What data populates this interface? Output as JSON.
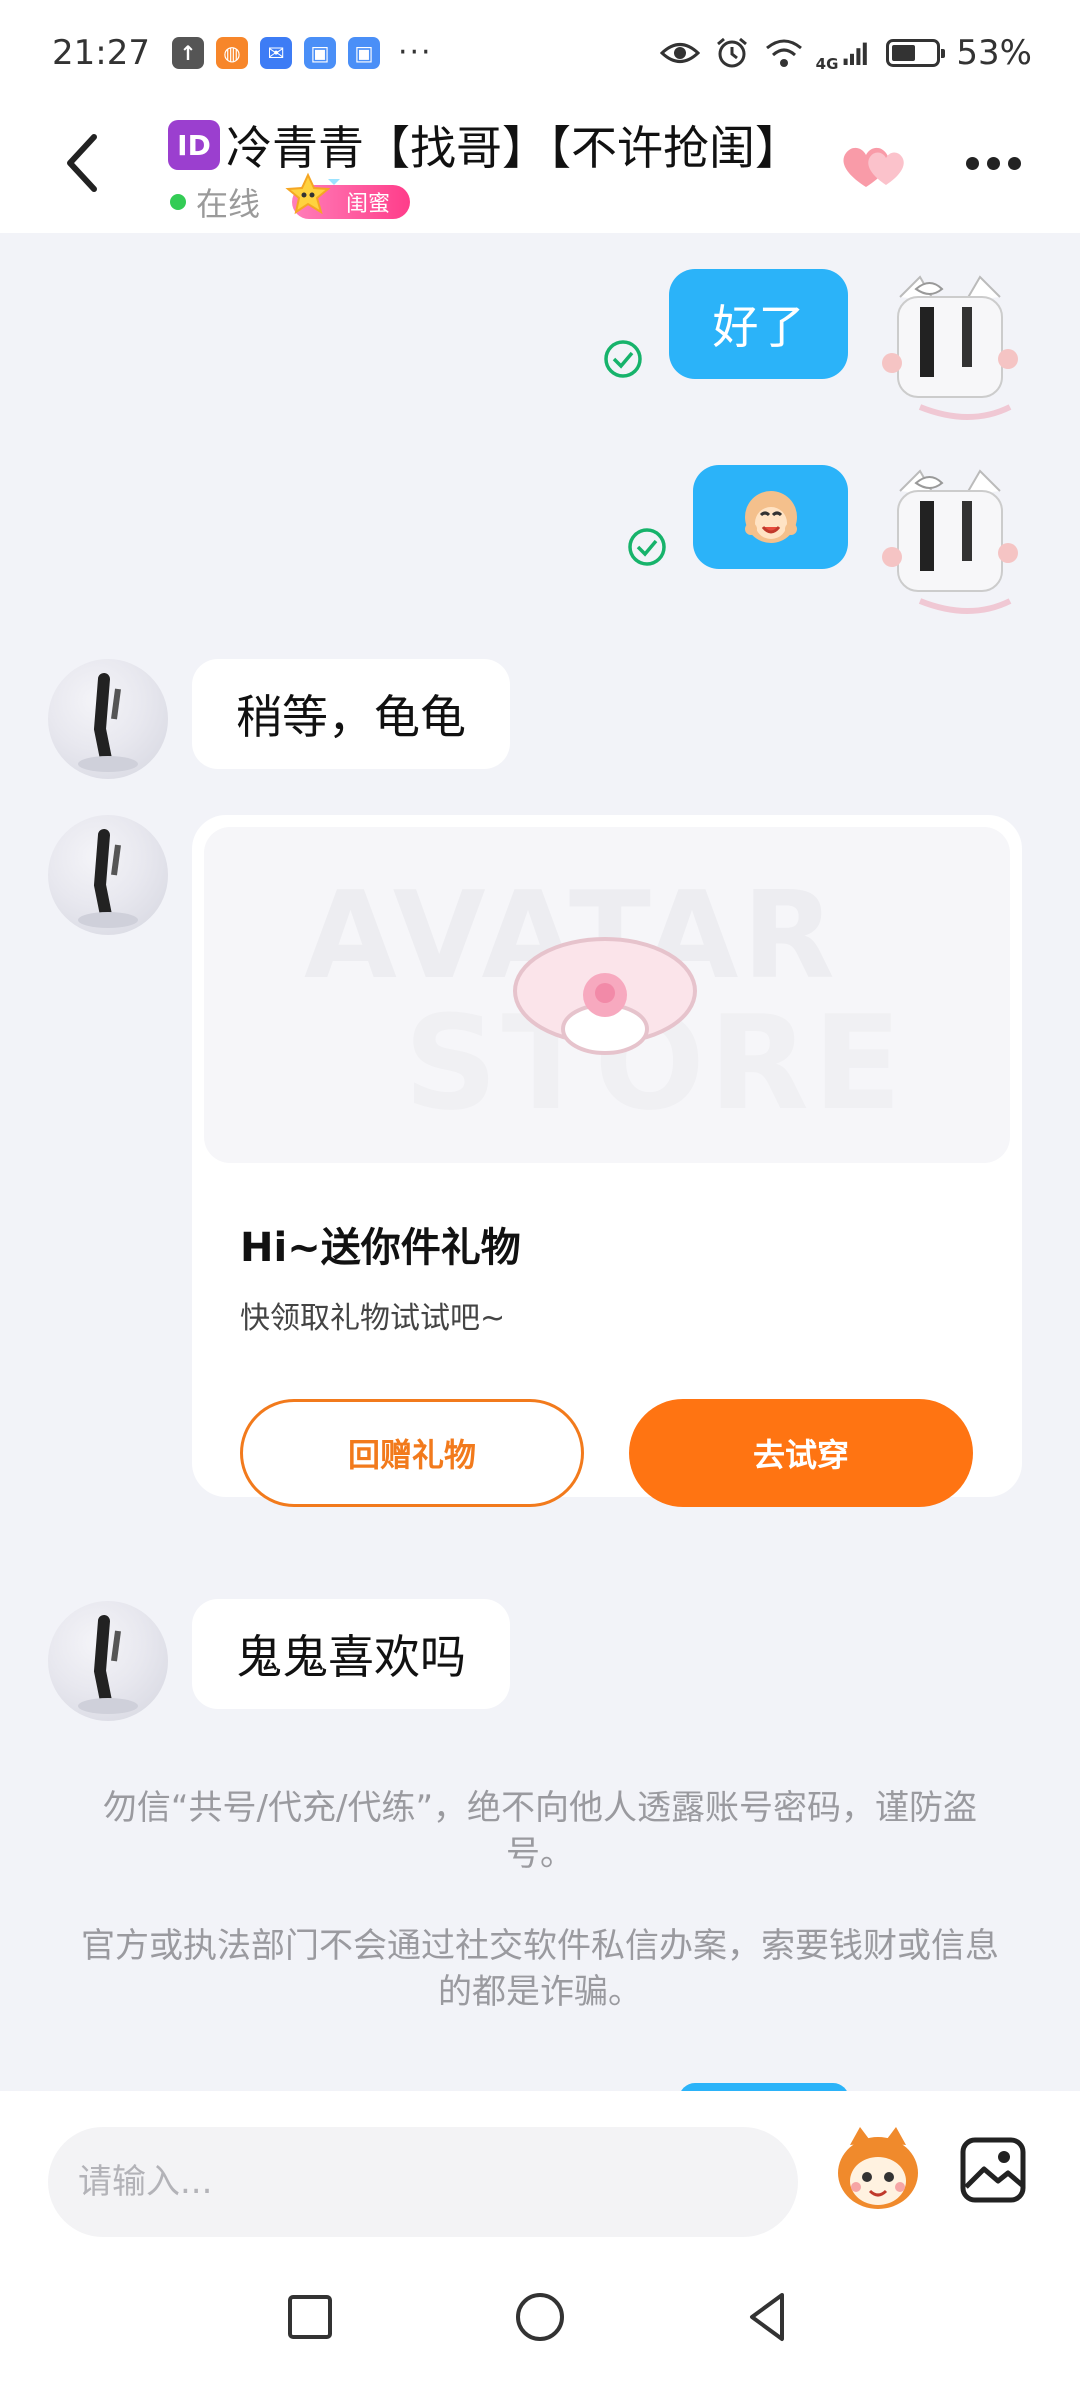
{
  "status_bar": {
    "time": "21:27",
    "more_notifications": "···",
    "network": "4G",
    "battery_percent": "53%",
    "battery_level": 0.53
  },
  "header": {
    "id_badge": "ID",
    "title": "冷青青【找哥】【不许抢闺】",
    "status": "在线",
    "relation_tag": "闺蜜"
  },
  "messages": [
    {
      "side": "out",
      "type": "text",
      "text": "好了"
    },
    {
      "side": "out",
      "type": "sticker",
      "sticker": "monkey-face-sticker"
    },
    {
      "side": "in",
      "type": "text",
      "text": "稍等，龟龟"
    },
    {
      "side": "in",
      "type": "gift"
    },
    {
      "side": "in",
      "type": "text",
      "text": "鬼鬼喜欢吗"
    }
  ],
  "gift_card": {
    "watermark_line1": "AVATAR",
    "watermark_line2": "STORE",
    "title": "Hi~送你件礼物",
    "subtitle": "快领取礼物试试吧~",
    "return_gift_label": "回赠礼物",
    "try_on_label": "去试穿"
  },
  "notices": [
    "勿信“共号/代充/代练”，绝不向他人透露账号密码，谨防盗号。",
    "官方或执法部门不会通过社交软件私信办案，索要钱财或信息的都是诈骗。"
  ],
  "input": {
    "placeholder": "请输入..."
  },
  "colors": {
    "outgoing_bubble": "#2bb3f9",
    "accent_orange": "#ff7412",
    "online_green": "#33cc55",
    "page_background": "#f2f3f8"
  }
}
